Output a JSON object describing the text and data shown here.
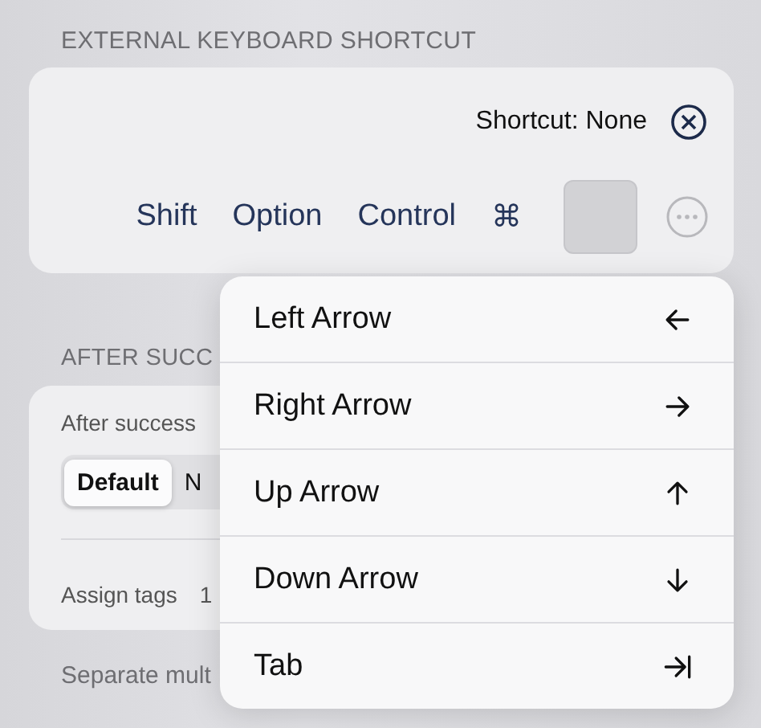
{
  "shortcut_section": {
    "header": "EXTERNAL KEYBOARD SHORTCUT",
    "shortcut_label": "Shortcut: None",
    "modifiers": [
      {
        "label": "Shift"
      },
      {
        "label": "Option"
      },
      {
        "label": "Control"
      },
      {
        "label": "⌘"
      }
    ]
  },
  "after_section": {
    "header": "AFTER SUCC",
    "after_label": "After success",
    "segments": [
      {
        "label": "Default",
        "selected": true
      },
      {
        "label": "N",
        "selected": false
      }
    ],
    "assign_label": "Assign tags",
    "assign_value": "1",
    "footer": "Separate mult"
  },
  "menu": {
    "items": [
      {
        "label": "Left Arrow",
        "kind": "left"
      },
      {
        "label": "Right Arrow",
        "kind": "right"
      },
      {
        "label": "Up Arrow",
        "kind": "up"
      },
      {
        "label": "Down Arrow",
        "kind": "down"
      },
      {
        "label": "Tab",
        "kind": "tab"
      }
    ]
  }
}
